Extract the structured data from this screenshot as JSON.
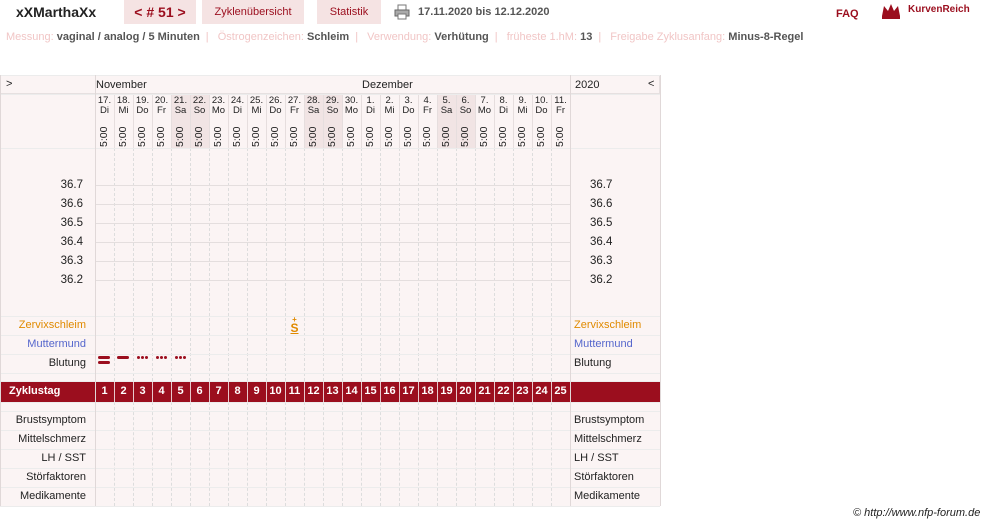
{
  "header": {
    "username": "xXMarthaXx",
    "cycle_nav": "< # 51 >",
    "tab_overview": "Zyklenübersicht",
    "tab_stats": "Statistik",
    "date_range": "17.11.2020 bis 12.12.2020",
    "faq": "FAQ",
    "brand": "KurvenReich"
  },
  "info": [
    {
      "label": "Messung:",
      "value": "vaginal / analog / 5 Minuten"
    },
    {
      "label": "Östrogenzeichen:",
      "value": "Schleim"
    },
    {
      "label": "Verwendung:",
      "value": "Verhütung"
    },
    {
      "label": "früheste 1.hM:",
      "value": "13"
    },
    {
      "label": "Freigabe Zyklusanfang:",
      "value": "Minus-8-Regel"
    }
  ],
  "grid": {
    "nav_left": ">",
    "nav_right": "<",
    "month1": "November",
    "month2": "Dezember",
    "year": "2020",
    "days": [
      {
        "d": "17.",
        "w": "Di",
        "we": false
      },
      {
        "d": "18.",
        "w": "Mi",
        "we": false
      },
      {
        "d": "19.",
        "w": "Do",
        "we": false
      },
      {
        "d": "20.",
        "w": "Fr",
        "we": false
      },
      {
        "d": "21.",
        "w": "Sa",
        "we": true
      },
      {
        "d": "22.",
        "w": "So",
        "we": true
      },
      {
        "d": "23.",
        "w": "Mo",
        "we": false
      },
      {
        "d": "24.",
        "w": "Di",
        "we": false
      },
      {
        "d": "25.",
        "w": "Mi",
        "we": false
      },
      {
        "d": "26.",
        "w": "Do",
        "we": false
      },
      {
        "d": "27.",
        "w": "Fr",
        "we": false
      },
      {
        "d": "28.",
        "w": "Sa",
        "we": true
      },
      {
        "d": "29.",
        "w": "So",
        "we": true
      },
      {
        "d": "30.",
        "w": "Mo",
        "we": false
      },
      {
        "d": "1.",
        "w": "Di",
        "we": false
      },
      {
        "d": "2.",
        "w": "Mi",
        "we": false
      },
      {
        "d": "3.",
        "w": "Do",
        "we": false
      },
      {
        "d": "4.",
        "w": "Fr",
        "we": false
      },
      {
        "d": "5.",
        "w": "Sa",
        "we": true
      },
      {
        "d": "6.",
        "w": "So",
        "we": true
      },
      {
        "d": "7.",
        "w": "Mo",
        "we": false
      },
      {
        "d": "8.",
        "w": "Di",
        "we": false
      },
      {
        "d": "9.",
        "w": "Mi",
        "we": false
      },
      {
        "d": "10.",
        "w": "Do",
        "we": false
      },
      {
        "d": "11.",
        "w": "Fr",
        "we": false
      }
    ],
    "time_label": "5:00",
    "temps": [
      "36.7",
      "36.6",
      "36.5",
      "36.4",
      "36.3",
      "36.2"
    ],
    "row_labels": {
      "zervix": "Zervixschleim",
      "muttermund": "Muttermund",
      "blutung": "Blutung",
      "zyklustag": "Zyklustag",
      "brust": "Brustsymptom",
      "mittel": "Mittelschmerz",
      "lh": "LH / SST",
      "stoer": "Störfaktoren",
      "medi": "Medikamente"
    },
    "zervix_mark": "S",
    "zervix_mark_top": "+",
    "cycle_days": [
      "1",
      "2",
      "3",
      "4",
      "5",
      "6",
      "7",
      "8",
      "9",
      "10",
      "11",
      "12",
      "13",
      "14",
      "15",
      "16",
      "17",
      "18",
      "19",
      "20",
      "21",
      "22",
      "23",
      "24",
      "25"
    ],
    "bleeding": [
      "heavy",
      "medium",
      "light",
      "light",
      "light",
      "",
      "",
      "",
      "",
      "",
      "",
      "",
      "",
      "",
      "",
      "",
      "",
      "",
      "",
      "",
      "",
      "",
      "",
      "",
      ""
    ],
    "colors": {
      "accent": "#9b0e1e",
      "zervix": "#e08a00",
      "muttermund": "#5566cc",
      "weekend": "#f1e4e4"
    }
  },
  "footer": {
    "copyright": "© http://www.nfp-forum.de"
  }
}
